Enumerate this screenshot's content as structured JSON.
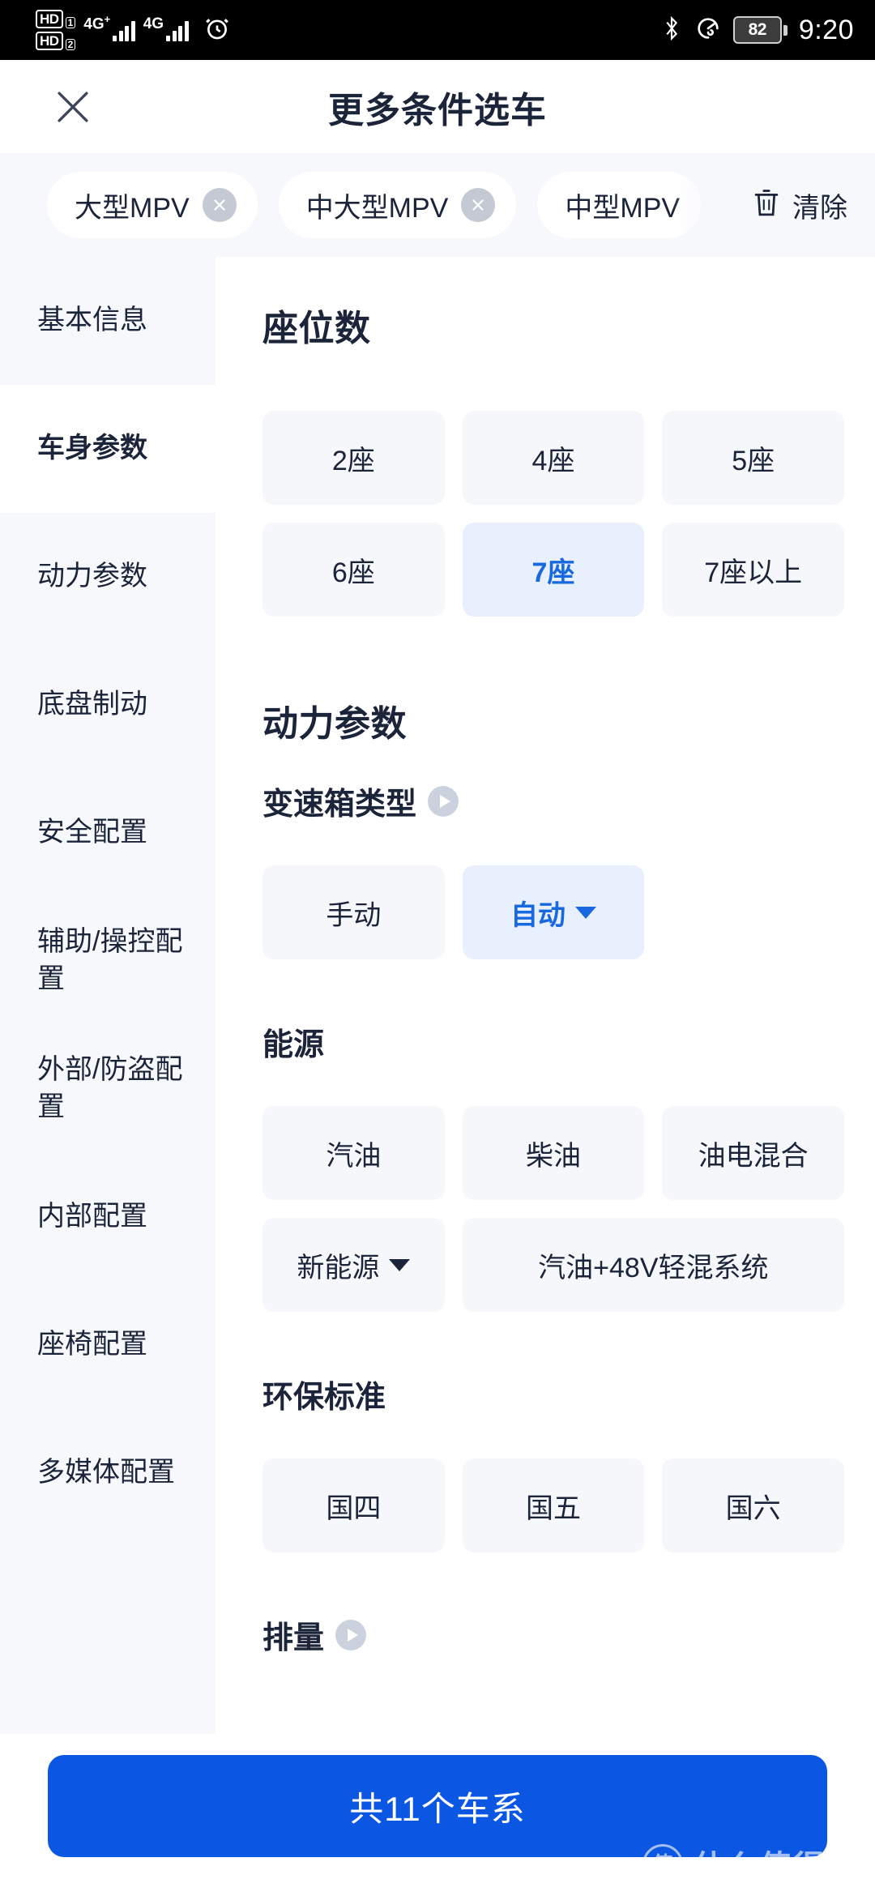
{
  "status_bar": {
    "volte_badges": [
      {
        "hd": "HD",
        "sim": "1"
      },
      {
        "hd": "HD",
        "sim": "2"
      }
    ],
    "network_primary": "4G",
    "network_primary_plus": "+",
    "network_secondary": "4G",
    "alarm_icon": "alarm-clock-icon",
    "bluetooth_icon": "bluetooth-icon",
    "data_saver_icon": "speed-meter-icon",
    "battery_level": "82",
    "time": "9:20"
  },
  "header": {
    "close_icon": "close-icon",
    "title": "更多条件选车"
  },
  "filter_chips": {
    "items": [
      {
        "label": "大型MPV",
        "removable": true
      },
      {
        "label": "中大型MPV",
        "removable": true
      },
      {
        "label": "中型MPV",
        "removable": false
      }
    ],
    "clear_label": "清除",
    "clear_icon": "trash-icon"
  },
  "sidebar": {
    "items": [
      {
        "label": "基本信息",
        "active": false
      },
      {
        "label": "车身参数",
        "active": true
      },
      {
        "label": "动力参数",
        "active": false
      },
      {
        "label": "底盘制动",
        "active": false
      },
      {
        "label": "安全配置",
        "active": false
      },
      {
        "label": "辅助/操控配置",
        "active": false
      },
      {
        "label": "外部/防盗配置",
        "active": false
      },
      {
        "label": "内部配置",
        "active": false
      },
      {
        "label": "座椅配置",
        "active": false
      },
      {
        "label": "多媒体配置",
        "active": false
      }
    ]
  },
  "content": {
    "seats": {
      "title": "座位数",
      "options": [
        {
          "label": "2座",
          "selected": false,
          "dropdown": false,
          "wide": false
        },
        {
          "label": "4座",
          "selected": false,
          "dropdown": false,
          "wide": false
        },
        {
          "label": "5座",
          "selected": false,
          "dropdown": false,
          "wide": false
        },
        {
          "label": "6座",
          "selected": false,
          "dropdown": false,
          "wide": false
        },
        {
          "label": "7座",
          "selected": true,
          "dropdown": false,
          "wide": false
        },
        {
          "label": "7座以上",
          "selected": false,
          "dropdown": false,
          "wide": false
        }
      ]
    },
    "power_section_title": "动力参数",
    "transmission": {
      "title": "变速箱类型",
      "has_play_icon": true,
      "options": [
        {
          "label": "手动",
          "selected": false,
          "dropdown": false,
          "wide": false
        },
        {
          "label": "自动",
          "selected": true,
          "dropdown": true,
          "wide": false
        }
      ]
    },
    "energy": {
      "title": "能源",
      "has_play_icon": false,
      "options": [
        {
          "label": "汽油",
          "selected": false,
          "dropdown": false,
          "wide": false
        },
        {
          "label": "柴油",
          "selected": false,
          "dropdown": false,
          "wide": false
        },
        {
          "label": "油电混合",
          "selected": false,
          "dropdown": false,
          "wide": false
        },
        {
          "label": "新能源",
          "selected": false,
          "dropdown": true,
          "wide": false
        },
        {
          "label": "汽油+48V轻混系统",
          "selected": false,
          "dropdown": false,
          "wide": true
        }
      ]
    },
    "emission": {
      "title": "环保标准",
      "has_play_icon": false,
      "options": [
        {
          "label": "国四",
          "selected": false,
          "dropdown": false,
          "wide": false
        },
        {
          "label": "国五",
          "selected": false,
          "dropdown": false,
          "wide": false
        },
        {
          "label": "国六",
          "selected": false,
          "dropdown": false,
          "wide": false
        }
      ]
    },
    "displacement": {
      "title": "排量",
      "has_play_icon": true
    }
  },
  "bottom": {
    "cta_label": "共11个车系"
  },
  "watermark": {
    "logo_char": "值",
    "text": "什么值得买"
  },
  "colors": {
    "accent_blue": "#0b57e3",
    "selected_blue": "#1868e0",
    "selected_bg": "#e9f0fd",
    "option_bg": "#f5f7fb",
    "panel_bg": "#f6f8fb",
    "text_dark": "#1b2438"
  }
}
